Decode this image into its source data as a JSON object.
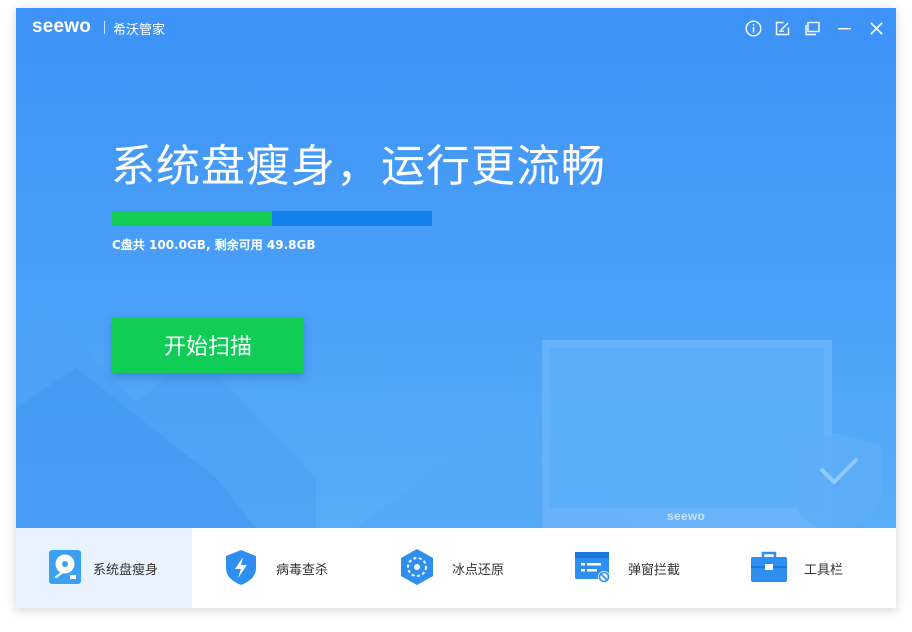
{
  "titlebar": {
    "logo": "seewo",
    "app_name": "希沃管家",
    "buttons": [
      "info-icon",
      "feedback-icon",
      "skin-icon",
      "minimize-icon",
      "close-icon"
    ]
  },
  "hero": {
    "headline": "系统盘瘦身，运行更流畅",
    "disk": {
      "used_fraction": 0.5,
      "info_prefix": "C盘共 ",
      "total": "100.0GB",
      "info_mid": ", 剩余可用 ",
      "free": "49.8GB"
    },
    "scan_button_label": "开始扫描",
    "monitor_brand": "seewo"
  },
  "nav": {
    "items": [
      {
        "label": "系统盘瘦身",
        "icon": "disk-cleanup-icon",
        "active": true
      },
      {
        "label": "病毒查杀",
        "icon": "shield-lightning-icon",
        "active": false
      },
      {
        "label": "冰点还原",
        "icon": "freeze-restore-icon",
        "active": false
      },
      {
        "label": "弹窗拦截",
        "icon": "popup-block-icon",
        "active": false
      },
      {
        "label": "工具栏",
        "icon": "toolbox-icon",
        "active": false
      }
    ]
  },
  "colors": {
    "hero_blue": "#3d93f6",
    "progress_used": "#14cc55",
    "progress_track": "#1481ee",
    "scan_button": "#10cd57",
    "nav_active_bg": "#e8f3ff"
  }
}
